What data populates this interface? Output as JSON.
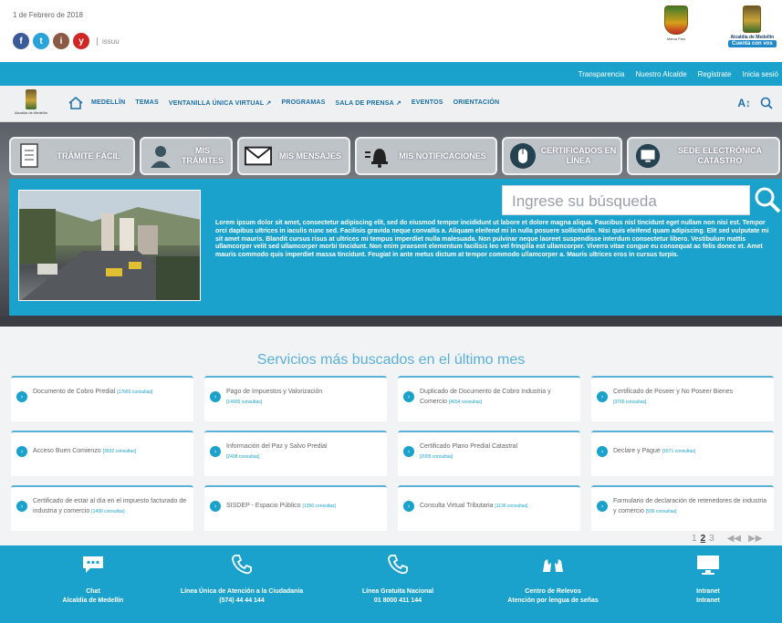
{
  "header": {
    "date": "1 de Febrero de 2018",
    "social": [
      "f",
      "t",
      "i",
      "y"
    ],
    "issuu": "issuu",
    "shield_caption": "Marca País",
    "alcaldia": "Alcaldía de Medellín",
    "alcaldia_pill": "Cuenta con vos"
  },
  "top_nav": [
    "Transparencia",
    "Nuestro Alcalde",
    "Regístrate",
    "Inicia sesió"
  ],
  "main_nav": {
    "logo_caption": "Alcaldía de Medellín",
    "items": [
      "MEDELLÍN",
      "TEMAS",
      "VENTANILLA ÚNICA VIRTUAL ↗",
      "PROGRAMAS",
      "SALA DE PRENSA ↗",
      "EVENTOS",
      "ORIENTACIÓN"
    ],
    "text_size": "A↕",
    "search_icon": "search-icon"
  },
  "tiles": [
    {
      "label": "TRÁMITE FÁCIL",
      "icon": "document-icon"
    },
    {
      "label": "MIS TRÁMITES",
      "icon": "user-icon"
    },
    {
      "label": "MIS MENSAJES",
      "icon": "envelope-icon"
    },
    {
      "label": "MIS NOTIFICACIONES",
      "icon": "bell-icon"
    },
    {
      "label": "CERTIFICADOS EN LÍNEA",
      "icon": "mouse-icon"
    },
    {
      "label": "SEDE ELECTRÓNICA CATASTRO",
      "icon": "monitor-icon"
    }
  ],
  "search": {
    "placeholder": "Ingrese su búsqueda"
  },
  "hero_text": "Lorem ipsum dolor sit amet, consectetur adipiscing elit, sed do eiusmod tempor incididunt ut labore et dolore magna aliqua. Faucibus nisl tincidunt eget nullam non nisi est. Tempor orci dapibus ultrices in iaculis nunc sed. Facilisis gravida neque convallis a. Aliquam eleifend mi in nulla posuere sollicitudin. Nisi quis eleifend quam adipiscing. Elit sed vulputate mi sit amet mauris. Blandit cursus risus at ultrices mi tempus imperdiet nulla malesuada. Non pulvinar neque laoreet suspendisse interdum consectetur libero. Vestibulum mattis ullamcorper velit sed ullamcorper morbi tincidunt. Non enim praesent elementum facilisis leo vel fringilla est ullamcorper. Viverra vitae congue eu consequat ac felis donec et. Amet mauris commodo quis imperdiet massa tincidunt. Feugiat in ante metus dictum at tempor commodo ullamcorper a. Mauris ultrices eros in cursus turpis.",
  "services": {
    "title": "Servicios más buscados en el último mes",
    "rows": [
      [
        {
          "text": "Documento de Cobro Predial",
          "count": "[17681 consultas]"
        },
        {
          "text": "Pago de Impuestos y Valorización",
          "count": "[14005 consultas]"
        },
        {
          "text": "Duplicado de Documento de Cobro Industria y Comercio",
          "count": "[4654 consultas]"
        },
        {
          "text": "Certificado de Poseer y No Poseer Bienes",
          "count": "[3766 consultas]"
        }
      ],
      [
        {
          "text": "Acceso Buen Comienzo",
          "count": "[3632 consultas]"
        },
        {
          "text": "Información del Paz y Salvo Predial",
          "count": "[2498 consultas]"
        },
        {
          "text": "Certificado Plano Predial Catastral",
          "count": "[2005 consultas]"
        },
        {
          "text": "Declare y Pague",
          "count": "[1671 consultas]"
        }
      ],
      [
        {
          "text": "Certificado de estar al día en el impuesto facturado de industria y comercio",
          "count": "[1499 consultas]"
        },
        {
          "text": "SISDEP - Espacio Público",
          "count": "[1356 consultas]"
        },
        {
          "text": "Consulta Virtual Tributaria",
          "count": "[1136 consultas]"
        },
        {
          "text": "Formulario de declaración de retenedores de industria y comercio",
          "count": "[936 consultas]"
        }
      ]
    ],
    "pager": {
      "p1": "1",
      "p2": "2",
      "p3": "3",
      "prev": "◀◀",
      "next": "▶▶"
    }
  },
  "footer": [
    {
      "icon": "chat-icon",
      "l1": "Chat",
      "l2": "Alcaldía de Medellín"
    },
    {
      "icon": "phone-icon",
      "l1": "Línea Única de Atención a la Ciudadanía",
      "l2": "(574) 44 44 144"
    },
    {
      "icon": "phone-icon",
      "l1": "Línea Gratuita Nacional",
      "l2": "01 8000 411 144"
    },
    {
      "icon": "sign-language-icon",
      "l1": "Centro de Relevos",
      "l2": "Atención por lengua de señas"
    },
    {
      "icon": "monitor-icon",
      "l1": "Intranet",
      "l2": "Intranet"
    }
  ],
  "colors": {
    "primary": "#1aa2cc",
    "nav_text": "#1a6fa8",
    "title": "#5ab0d8"
  }
}
